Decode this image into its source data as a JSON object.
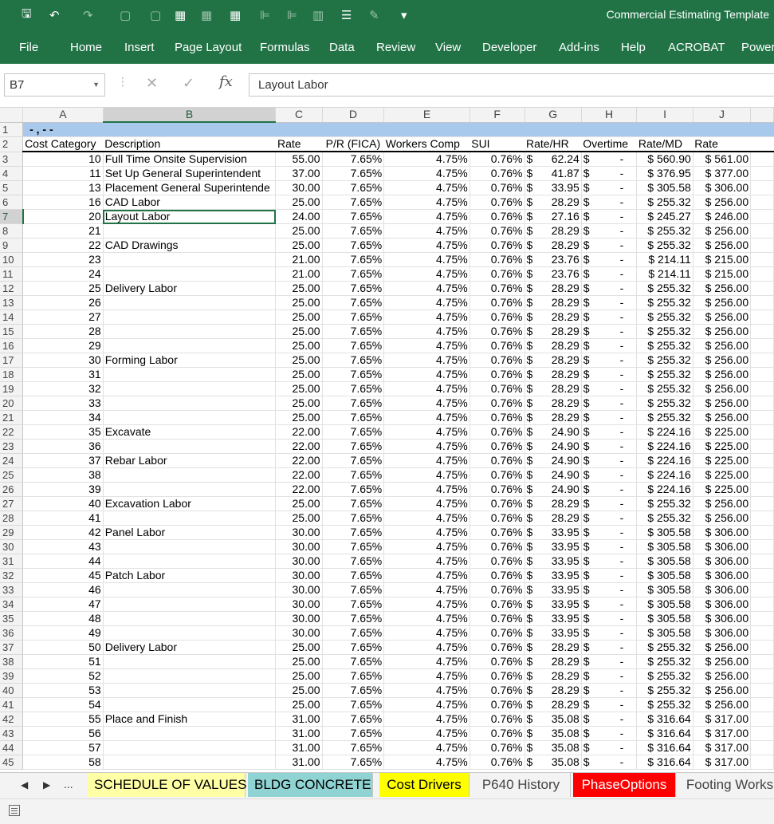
{
  "app": {
    "title": "Commercial Estimating Template",
    "quick_access": [
      "save-icon",
      "undo-icon",
      "redo-icon",
      "form-icon",
      "form-icon",
      "table-icon",
      "table-icon",
      "grid-icon",
      "align-icon",
      "align-icon",
      "chart-icon",
      "list-icon",
      "paint-icon",
      "customize-icon"
    ]
  },
  "ribbon": {
    "tabs": [
      "File",
      "Home",
      "Insert",
      "Page Layout",
      "Formulas",
      "Data",
      "Review",
      "View",
      "Developer",
      "Add-ins",
      "Help",
      "ACROBAT",
      "Power"
    ]
  },
  "formula_bar": {
    "name_box": "B7",
    "cancel": "✕",
    "enter": "✓",
    "fx": "fx",
    "content": "Layout Labor"
  },
  "sheet": {
    "columns": [
      "A",
      "B",
      "C",
      "D",
      "E",
      "F",
      "G",
      "H",
      "I",
      "J"
    ],
    "row1_text": "- ,   -   -",
    "headers": [
      "Cost Category",
      "Description",
      "Rate",
      "P/R (FICA)",
      "Workers Comp",
      "SUI",
      "Rate/HR",
      "Overtime",
      "Rate/MD",
      "Rate"
    ],
    "rows": [
      {
        "n": "3",
        "a": "10",
        "b": "Full Time Onsite Supervision",
        "c": "55.00",
        "d": "7.65%",
        "e": "4.75%",
        "f": "0.76%",
        "g": "62.24",
        "h": "-",
        "i": "$ 560.90",
        "j": "$ 561.00"
      },
      {
        "n": "4",
        "a": "11",
        "b": "Set Up General Superintendent",
        "c": "37.00",
        "d": "7.65%",
        "e": "4.75%",
        "f": "0.76%",
        "g": "41.87",
        "h": "-",
        "i": "$ 376.95",
        "j": "$ 377.00"
      },
      {
        "n": "5",
        "a": "13",
        "b": "Placement General Superintende",
        "c": "30.00",
        "d": "7.65%",
        "e": "4.75%",
        "f": "0.76%",
        "g": "33.95",
        "h": "-",
        "i": "$ 305.58",
        "j": "$ 306.00"
      },
      {
        "n": "6",
        "a": "16",
        "b": "CAD Labor",
        "c": "25.00",
        "d": "7.65%",
        "e": "4.75%",
        "f": "0.76%",
        "g": "28.29",
        "h": "-",
        "i": "$ 255.32",
        "j": "$ 256.00"
      },
      {
        "n": "7",
        "a": "20",
        "b": "Layout Labor",
        "c": "24.00",
        "d": "7.65%",
        "e": "4.75%",
        "f": "0.76%",
        "g": "27.16",
        "h": "-",
        "i": "$ 245.27",
        "j": "$ 246.00"
      },
      {
        "n": "8",
        "a": "21",
        "b": "",
        "c": "25.00",
        "d": "7.65%",
        "e": "4.75%",
        "f": "0.76%",
        "g": "28.29",
        "h": "-",
        "i": "$ 255.32",
        "j": "$ 256.00"
      },
      {
        "n": "9",
        "a": "22",
        "b": "CAD Drawings",
        "c": "25.00",
        "d": "7.65%",
        "e": "4.75%",
        "f": "0.76%",
        "g": "28.29",
        "h": "-",
        "i": "$ 255.32",
        "j": "$ 256.00"
      },
      {
        "n": "10",
        "a": "23",
        "b": "",
        "c": "21.00",
        "d": "7.65%",
        "e": "4.75%",
        "f": "0.76%",
        "g": "23.76",
        "h": "-",
        "i": "$ 214.11",
        "j": "$ 215.00"
      },
      {
        "n": "11",
        "a": "24",
        "b": "",
        "c": "21.00",
        "d": "7.65%",
        "e": "4.75%",
        "f": "0.76%",
        "g": "23.76",
        "h": "-",
        "i": "$ 214.11",
        "j": "$ 215.00"
      },
      {
        "n": "12",
        "a": "25",
        "b": "Delivery Labor",
        "c": "25.00",
        "d": "7.65%",
        "e": "4.75%",
        "f": "0.76%",
        "g": "28.29",
        "h": "-",
        "i": "$ 255.32",
        "j": "$ 256.00"
      },
      {
        "n": "13",
        "a": "26",
        "b": "",
        "c": "25.00",
        "d": "7.65%",
        "e": "4.75%",
        "f": "0.76%",
        "g": "28.29",
        "h": "-",
        "i": "$ 255.32",
        "j": "$ 256.00"
      },
      {
        "n": "14",
        "a": "27",
        "b": "",
        "c": "25.00",
        "d": "7.65%",
        "e": "4.75%",
        "f": "0.76%",
        "g": "28.29",
        "h": "-",
        "i": "$ 255.32",
        "j": "$ 256.00"
      },
      {
        "n": "15",
        "a": "28",
        "b": "",
        "c": "25.00",
        "d": "7.65%",
        "e": "4.75%",
        "f": "0.76%",
        "g": "28.29",
        "h": "-",
        "i": "$ 255.32",
        "j": "$ 256.00"
      },
      {
        "n": "16",
        "a": "29",
        "b": "",
        "c": "25.00",
        "d": "7.65%",
        "e": "4.75%",
        "f": "0.76%",
        "g": "28.29",
        "h": "-",
        "i": "$ 255.32",
        "j": "$ 256.00"
      },
      {
        "n": "17",
        "a": "30",
        "b": "Forming Labor",
        "c": "25.00",
        "d": "7.65%",
        "e": "4.75%",
        "f": "0.76%",
        "g": "28.29",
        "h": "-",
        "i": "$ 255.32",
        "j": "$ 256.00"
      },
      {
        "n": "18",
        "a": "31",
        "b": "",
        "c": "25.00",
        "d": "7.65%",
        "e": "4.75%",
        "f": "0.76%",
        "g": "28.29",
        "h": "-",
        "i": "$ 255.32",
        "j": "$ 256.00"
      },
      {
        "n": "19",
        "a": "32",
        "b": "",
        "c": "25.00",
        "d": "7.65%",
        "e": "4.75%",
        "f": "0.76%",
        "g": "28.29",
        "h": "-",
        "i": "$ 255.32",
        "j": "$ 256.00"
      },
      {
        "n": "20",
        "a": "33",
        "b": "",
        "c": "25.00",
        "d": "7.65%",
        "e": "4.75%",
        "f": "0.76%",
        "g": "28.29",
        "h": "-",
        "i": "$ 255.32",
        "j": "$ 256.00"
      },
      {
        "n": "21",
        "a": "34",
        "b": "",
        "c": "25.00",
        "d": "7.65%",
        "e": "4.75%",
        "f": "0.76%",
        "g": "28.29",
        "h": "-",
        "i": "$ 255.32",
        "j": "$ 256.00"
      },
      {
        "n": "22",
        "a": "35",
        "b": "Excavate",
        "c": "22.00",
        "d": "7.65%",
        "e": "4.75%",
        "f": "0.76%",
        "g": "24.90",
        "h": "-",
        "i": "$ 224.16",
        "j": "$ 225.00"
      },
      {
        "n": "23",
        "a": "36",
        "b": "",
        "c": "22.00",
        "d": "7.65%",
        "e": "4.75%",
        "f": "0.76%",
        "g": "24.90",
        "h": "-",
        "i": "$ 224.16",
        "j": "$ 225.00"
      },
      {
        "n": "24",
        "a": "37",
        "b": "Rebar Labor",
        "c": "22.00",
        "d": "7.65%",
        "e": "4.75%",
        "f": "0.76%",
        "g": "24.90",
        "h": "-",
        "i": "$ 224.16",
        "j": "$ 225.00"
      },
      {
        "n": "25",
        "a": "38",
        "b": "",
        "c": "22.00",
        "d": "7.65%",
        "e": "4.75%",
        "f": "0.76%",
        "g": "24.90",
        "h": "-",
        "i": "$ 224.16",
        "j": "$ 225.00"
      },
      {
        "n": "26",
        "a": "39",
        "b": "",
        "c": "22.00",
        "d": "7.65%",
        "e": "4.75%",
        "f": "0.76%",
        "g": "24.90",
        "h": "-",
        "i": "$ 224.16",
        "j": "$ 225.00"
      },
      {
        "n": "27",
        "a": "40",
        "b": "Excavation Labor",
        "c": "25.00",
        "d": "7.65%",
        "e": "4.75%",
        "f": "0.76%",
        "g": "28.29",
        "h": "-",
        "i": "$ 255.32",
        "j": "$ 256.00"
      },
      {
        "n": "28",
        "a": "41",
        "b": "",
        "c": "25.00",
        "d": "7.65%",
        "e": "4.75%",
        "f": "0.76%",
        "g": "28.29",
        "h": "-",
        "i": "$ 255.32",
        "j": "$ 256.00"
      },
      {
        "n": "29",
        "a": "42",
        "b": "Panel Labor",
        "c": "30.00",
        "d": "7.65%",
        "e": "4.75%",
        "f": "0.76%",
        "g": "33.95",
        "h": "-",
        "i": "$ 305.58",
        "j": "$ 306.00"
      },
      {
        "n": "30",
        "a": "43",
        "b": "",
        "c": "30.00",
        "d": "7.65%",
        "e": "4.75%",
        "f": "0.76%",
        "g": "33.95",
        "h": "-",
        "i": "$ 305.58",
        "j": "$ 306.00"
      },
      {
        "n": "31",
        "a": "44",
        "b": "",
        "c": "30.00",
        "d": "7.65%",
        "e": "4.75%",
        "f": "0.76%",
        "g": "33.95",
        "h": "-",
        "i": "$ 305.58",
        "j": "$ 306.00"
      },
      {
        "n": "32",
        "a": "45",
        "b": "Patch Labor",
        "c": "30.00",
        "d": "7.65%",
        "e": "4.75%",
        "f": "0.76%",
        "g": "33.95",
        "h": "-",
        "i": "$ 305.58",
        "j": "$ 306.00"
      },
      {
        "n": "33",
        "a": "46",
        "b": "",
        "c": "30.00",
        "d": "7.65%",
        "e": "4.75%",
        "f": "0.76%",
        "g": "33.95",
        "h": "-",
        "i": "$ 305.58",
        "j": "$ 306.00"
      },
      {
        "n": "34",
        "a": "47",
        "b": "",
        "c": "30.00",
        "d": "7.65%",
        "e": "4.75%",
        "f": "0.76%",
        "g": "33.95",
        "h": "-",
        "i": "$ 305.58",
        "j": "$ 306.00"
      },
      {
        "n": "35",
        "a": "48",
        "b": "",
        "c": "30.00",
        "d": "7.65%",
        "e": "4.75%",
        "f": "0.76%",
        "g": "33.95",
        "h": "-",
        "i": "$ 305.58",
        "j": "$ 306.00"
      },
      {
        "n": "36",
        "a": "49",
        "b": "",
        "c": "30.00",
        "d": "7.65%",
        "e": "4.75%",
        "f": "0.76%",
        "g": "33.95",
        "h": "-",
        "i": "$ 305.58",
        "j": "$ 306.00"
      },
      {
        "n": "37",
        "a": "50",
        "b": "Delivery Labor",
        "c": "25.00",
        "d": "7.65%",
        "e": "4.75%",
        "f": "0.76%",
        "g": "28.29",
        "h": "-",
        "i": "$ 255.32",
        "j": "$ 256.00"
      },
      {
        "n": "38",
        "a": "51",
        "b": "",
        "c": "25.00",
        "d": "7.65%",
        "e": "4.75%",
        "f": "0.76%",
        "g": "28.29",
        "h": "-",
        "i": "$ 255.32",
        "j": "$ 256.00"
      },
      {
        "n": "39",
        "a": "52",
        "b": "",
        "c": "25.00",
        "d": "7.65%",
        "e": "4.75%",
        "f": "0.76%",
        "g": "28.29",
        "h": "-",
        "i": "$ 255.32",
        "j": "$ 256.00"
      },
      {
        "n": "40",
        "a": "53",
        "b": "",
        "c": "25.00",
        "d": "7.65%",
        "e": "4.75%",
        "f": "0.76%",
        "g": "28.29",
        "h": "-",
        "i": "$ 255.32",
        "j": "$ 256.00"
      },
      {
        "n": "41",
        "a": "54",
        "b": "",
        "c": "25.00",
        "d": "7.65%",
        "e": "4.75%",
        "f": "0.76%",
        "g": "28.29",
        "h": "-",
        "i": "$ 255.32",
        "j": "$ 256.00"
      },
      {
        "n": "42",
        "a": "55",
        "b": "Place and Finish",
        "c": "31.00",
        "d": "7.65%",
        "e": "4.75%",
        "f": "0.76%",
        "g": "35.08",
        "h": "-",
        "i": "$ 316.64",
        "j": "$ 317.00"
      },
      {
        "n": "43",
        "a": "56",
        "b": "",
        "c": "31.00",
        "d": "7.65%",
        "e": "4.75%",
        "f": "0.76%",
        "g": "35.08",
        "h": "-",
        "i": "$ 316.64",
        "j": "$ 317.00"
      },
      {
        "n": "44",
        "a": "57",
        "b": "",
        "c": "31.00",
        "d": "7.65%",
        "e": "4.75%",
        "f": "0.76%",
        "g": "35.08",
        "h": "-",
        "i": "$ 316.64",
        "j": "$ 317.00"
      },
      {
        "n": "45",
        "a": "58",
        "b": "",
        "c": "31.00",
        "d": "7.65%",
        "e": "4.75%",
        "f": "0.76%",
        "g": "35.08",
        "h": "-",
        "i": "$ 316.64",
        "j": "$ 317.00"
      }
    ]
  },
  "sheet_tabs": {
    "nav_prev": "◀",
    "nav_next": "▶",
    "nav_more": "...",
    "tabs": [
      {
        "label": "SCHEDULE OF VALUES",
        "bg": "#ffffa6",
        "color": "#000"
      },
      {
        "label": "BLDG CONCRETE",
        "bg": "#8fd3d3",
        "color": "#000"
      },
      {
        "label": "Cost Drivers",
        "bg": "#ffff00",
        "color": "#000"
      },
      {
        "label": "P640 History",
        "bg": "#f3f3f3",
        "color": "#444"
      },
      {
        "label": "PhaseOptions",
        "bg": "#ff0000",
        "color": "#fff"
      },
      {
        "label": "Footing Works",
        "bg": "#f3f3f3",
        "color": "#444"
      }
    ]
  },
  "colors": {
    "accent": "#217346",
    "header_band": "#a8c8ec"
  }
}
